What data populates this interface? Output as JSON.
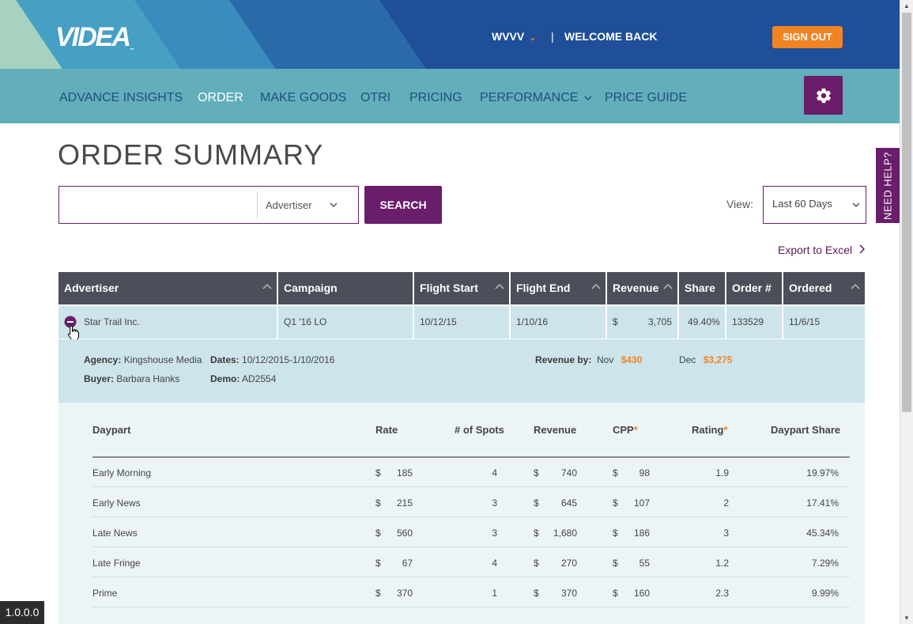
{
  "header": {
    "logo": "VIDEA",
    "logo_tm": "™",
    "station": "WVVV",
    "separator": "|",
    "welcome": "WELCOME BACK",
    "sign_out": "SIGN OUT"
  },
  "nav": {
    "items": [
      {
        "label": "ADVANCE INSIGHTS",
        "active": false
      },
      {
        "label": "ORDER",
        "active": true
      },
      {
        "label": "MAKE GOODS",
        "active": false
      },
      {
        "label": "OTRI",
        "active": false
      },
      {
        "label": "PRICING",
        "active": false
      },
      {
        "label": "PERFORMANCE",
        "active": false,
        "has_dropdown": true
      },
      {
        "label": "PRICE GUIDE",
        "active": false
      }
    ],
    "settings_icon": "gear-icon"
  },
  "need_help": "NEED HELP?",
  "page_title": "ORDER SUMMARY",
  "search": {
    "value": "",
    "type_selected": "Advertiser",
    "button": "SEARCH"
  },
  "view": {
    "label": "View:",
    "selected": "Last 60 Days"
  },
  "export": "Export to Excel",
  "table": {
    "columns": [
      "Advertiser",
      "Campaign",
      "Flight Start",
      "Flight End",
      "Revenue",
      "Share",
      "Order #",
      "Ordered"
    ],
    "row": {
      "advertiser": "Star Trail Inc.",
      "campaign": "Q1 '16 LO",
      "flight_start": "10/12/15",
      "flight_end": "1/10/16",
      "revenue_currency": "$",
      "revenue": "3,705",
      "share": "49.40%",
      "order_no": "133529",
      "ordered": "11/6/15"
    },
    "detail": {
      "agency_label": "Agency:",
      "agency": "Kingshouse Media",
      "dates_label": "Dates:",
      "dates": "10/12/2015-1/10/2016",
      "buyer_label": "Buyer:",
      "buyer": "Barbara Hanks",
      "demo_label": "Demo:",
      "demo": "AD2554",
      "revenue_by_label": "Revenue by:",
      "month1": "Nov",
      "month1_value": "$430",
      "month2": "Dec",
      "month2_value": "$3,275"
    }
  },
  "dayparts": {
    "columns": {
      "daypart": "Daypart",
      "rate": "Rate",
      "spots": "# of Spots",
      "revenue": "Revenue",
      "cpp": "CPP",
      "rating": "Rating",
      "share": "Daypart Share",
      "asterisk": "*"
    },
    "rows": [
      {
        "daypart": "Early Morning",
        "rate": "185",
        "spots": "4",
        "revenue": "740",
        "cpp": "98",
        "rating": "1.9",
        "share": "19.97%"
      },
      {
        "daypart": "Early News",
        "rate": "215",
        "spots": "3",
        "revenue": "645",
        "cpp": "107",
        "rating": "2",
        "share": "17.41%"
      },
      {
        "daypart": "Late News",
        "rate": "560",
        "spots": "3",
        "revenue": "1,680",
        "cpp": "186",
        "rating": "3",
        "share": "45.34%"
      },
      {
        "daypart": "Late Fringe",
        "rate": "67",
        "spots": "4",
        "revenue": "270",
        "cpp": "55",
        "rating": "1.2",
        "share": "7.29%"
      },
      {
        "daypart": "Prime",
        "rate": "370",
        "spots": "1",
        "revenue": "370",
        "cpp": "160",
        "rating": "2.3",
        "share": "9.99%"
      }
    ],
    "currency": "$"
  },
  "version": "1.0.0.0",
  "colors": {
    "brand_purple": "#6a1d6a",
    "accent_orange": "#f08423",
    "nav_teal": "#62aebb",
    "header_blue": "#1d4a8f",
    "table_header": "#4c4f5a",
    "row_highlight": "#cce4ea"
  }
}
